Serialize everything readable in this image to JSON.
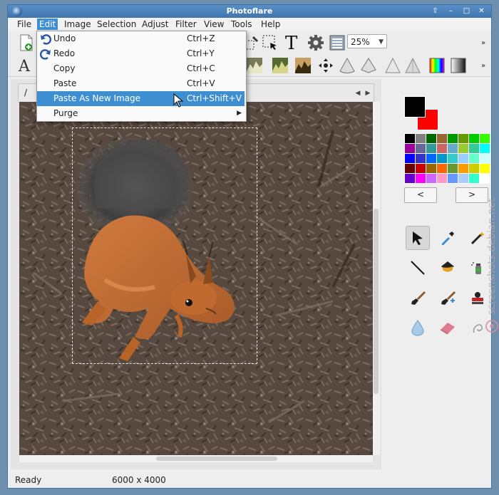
{
  "window": {
    "title": "Photoflare"
  },
  "menubar": {
    "items": [
      "File",
      "Edit",
      "Image",
      "Selection",
      "Adjust",
      "Filter",
      "View",
      "Tools",
      "Help"
    ],
    "active": "Edit"
  },
  "toolbar": {
    "zoom_value": "25%"
  },
  "document": {
    "tab_label": "/"
  },
  "edit_menu": {
    "items": [
      {
        "label": "Undo",
        "shortcut": "Ctrl+Z",
        "icon": "undo-icon"
      },
      {
        "label": "Redo",
        "shortcut": "Ctrl+Y",
        "icon": "redo-icon"
      },
      {
        "label": "Copy",
        "shortcut": "Ctrl+C"
      },
      {
        "label": "Paste",
        "shortcut": "Ctrl+V"
      },
      {
        "label": "Paste As New Image",
        "shortcut": "Ctrl+Shift+V",
        "highlighted": true
      },
      {
        "label": "Purge",
        "shortcut": "",
        "submenu": true
      }
    ]
  },
  "color_panel": {
    "foreground": "#000000",
    "background": "#ff0000",
    "prev_label": "<",
    "next_label": ">",
    "swatches": [
      "#000000",
      "#808080",
      "#006600",
      "#996633",
      "#009900",
      "#669900",
      "#00cc00",
      "#33ff00",
      "#990099",
      "#666699",
      "#339999",
      "#cc6666",
      "#66aacc",
      "#99cc33",
      "#33cc99",
      "#00ffff",
      "#0000ff",
      "#3333cc",
      "#0066ff",
      "#0099cc",
      "#33cccc",
      "#99ccff",
      "#66ffcc",
      "#ccffff",
      "#660000",
      "#cc0000",
      "#996600",
      "#ff6600",
      "#669933",
      "#ff9900",
      "#cccc00",
      "#ffff00",
      "#6600cc",
      "#ff00ff",
      "#cc66ff",
      "#ff99cc",
      "#6699ff",
      "#aaccff",
      "#33ffcc",
      "#ffffff"
    ]
  },
  "status": {
    "text": "Ready",
    "dimensions": "6000 x 4000"
  },
  "watermark": {
    "text": "screenshots.debian.net"
  }
}
